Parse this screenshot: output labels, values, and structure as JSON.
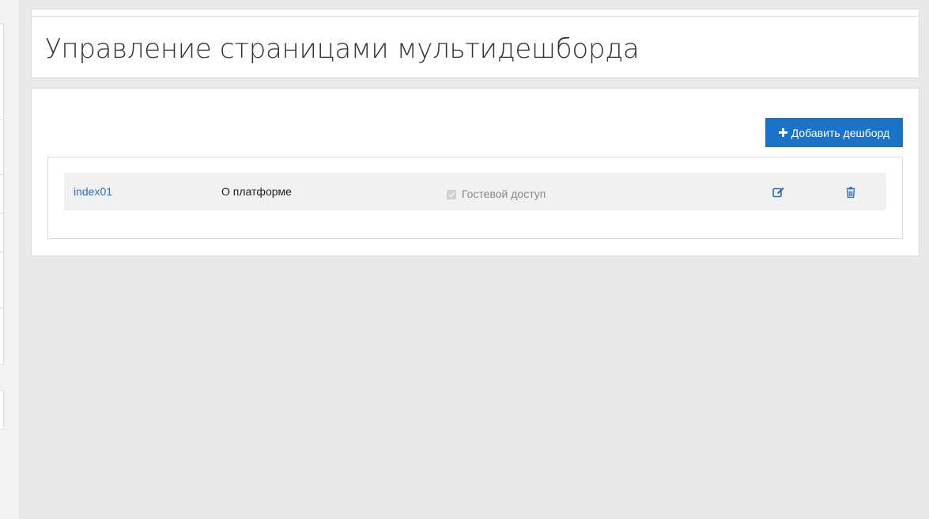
{
  "page": {
    "title": "Управление страницами мультидешборда"
  },
  "toolbar": {
    "add_label": "Добавить дешборд"
  },
  "dashboards": [
    {
      "name": "index01",
      "title": "О платформе",
      "guest_access_label": "Гостевой доступ",
      "guest_access": true
    }
  ],
  "colors": {
    "accent": "#1a73c9",
    "link": "#2a6ebd",
    "background": "#e9e9e9"
  },
  "icons": {
    "add": "plus-icon",
    "edit": "edit-icon",
    "delete": "trash-icon"
  }
}
